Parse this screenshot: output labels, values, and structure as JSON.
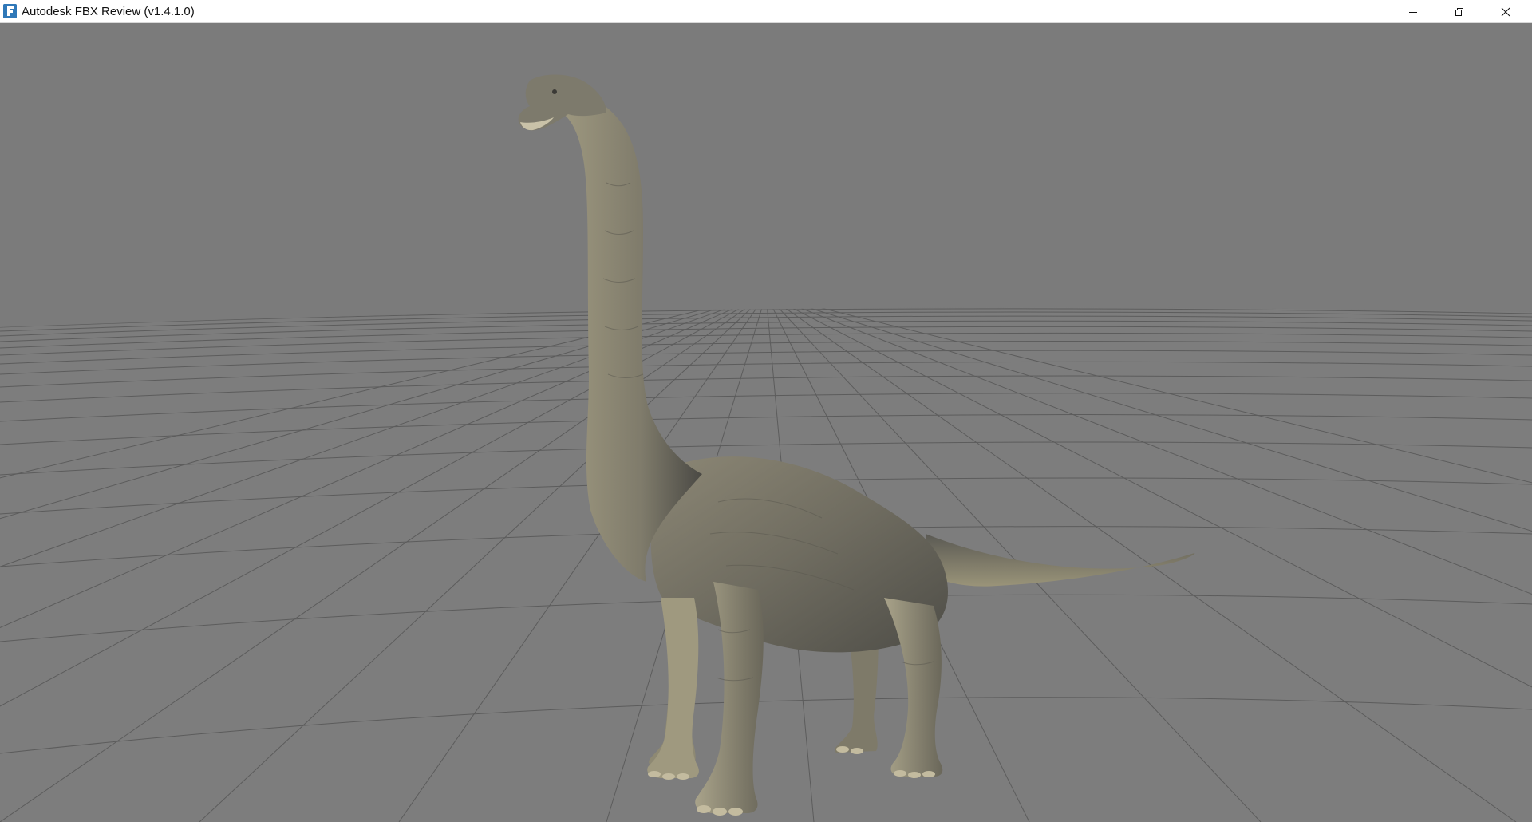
{
  "window": {
    "title": "Autodesk FBX Review (v1.4.1.0)",
    "app_icon": "fbx-review-icon",
    "controls": {
      "minimize_icon": "minimize-icon",
      "maximize_icon": "restore-icon",
      "close_icon": "close-icon"
    }
  },
  "viewport": {
    "background_color": "#7b7b7b",
    "grid_color": "#5a5a5a",
    "model": "brachiosaurus-model"
  }
}
